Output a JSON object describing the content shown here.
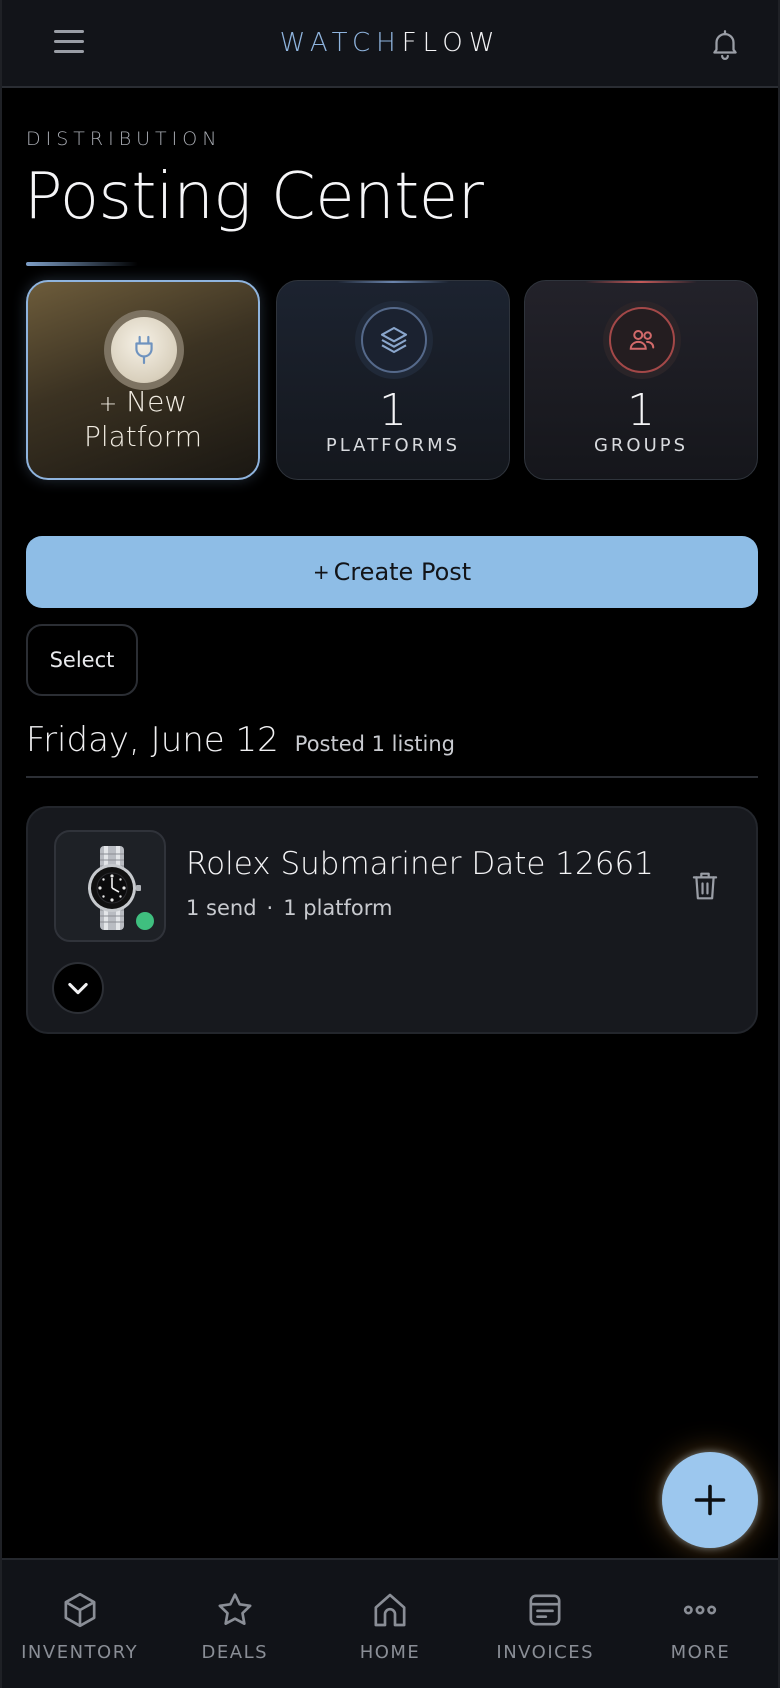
{
  "header": {
    "brand_part1": "WATCH",
    "brand_part2": "FLOW",
    "menu_icon": "hamburger-icon",
    "notification_icon": "bell-icon"
  },
  "page": {
    "kicker": "DISTRIBUTION",
    "title": "Posting Center"
  },
  "cards": {
    "new_platform": {
      "plus": "+",
      "label_line1": "New",
      "label_line2": "Platform",
      "icon": "plug-icon"
    },
    "platforms": {
      "value": "1",
      "label": "PLATFORMS",
      "icon": "layers-icon"
    },
    "groups": {
      "value": "1",
      "label": "GROUPS",
      "icon": "users-icon"
    }
  },
  "actions": {
    "create_plus": "+",
    "create_label": "Create Post",
    "select_label": "Select"
  },
  "date_group": {
    "date": "Friday, June 12",
    "summary": "Posted 1 listing"
  },
  "listing": {
    "title": "Rolex Submariner Date 12661...",
    "sends": "1 send",
    "separator": "·",
    "platforms": "1 platform",
    "status": "online",
    "status_color": "#3fbf7f"
  },
  "bottom_nav": [
    {
      "label": "INVENTORY",
      "icon": "cube-icon"
    },
    {
      "label": "DEALS",
      "icon": "star-icon"
    },
    {
      "label": "HOME",
      "icon": "home-icon"
    },
    {
      "label": "INVOICES",
      "icon": "invoice-icon"
    },
    {
      "label": "MORE",
      "icon": "more-icon"
    }
  ],
  "colors": {
    "accent": "#8ebde6",
    "background": "#000000",
    "card": "#17191e",
    "groups_accent": "#c45a5a"
  }
}
